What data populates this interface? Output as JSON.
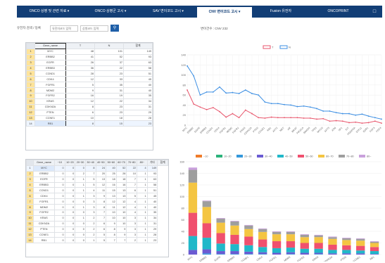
{
  "tabs": [
    {
      "label": "ONCO 상병 및 관련 자료 ▾",
      "active": false
    },
    {
      "label": "ONCO 상병군 고시 ▾",
      "active": false
    },
    {
      "label": "SAV 변이코드 고시 ▾",
      "active": false
    },
    {
      "label": "CNV 변이코드 고시 ▾",
      "active": true
    },
    {
      "label": "Fusion 유전자",
      "active": false
    },
    {
      "label": "ONCOPRINT",
      "active": false
    }
  ],
  "tab_icon": "window-icon",
  "filter": {
    "label": "유전자 검색 / 등록",
    "field1_placeholder": "유전자코드 입력",
    "field2_placeholder": "상병코드 입력",
    "search_icon": "search-icon"
  },
  "status_text": "변이건수 : CNV 232",
  "top_table": {
    "columns": [
      "Gene_name",
      "T",
      "N",
      "합계"
    ],
    "rows": [
      [
        "1",
        "MYC",
        "48",
        "101",
        "149"
      ],
      [
        "2",
        "ERBB2",
        "41",
        "52",
        "93"
      ],
      [
        "3",
        "EGFR",
        "26",
        "37",
        "63"
      ],
      [
        "4",
        "ERBB3",
        "36",
        "22",
        "58"
      ],
      [
        "5",
        "CCND1",
        "28",
        "23",
        "51"
      ],
      [
        "6",
        "CDK4",
        "12",
        "33",
        "45"
      ],
      [
        "7",
        "FGFR1",
        "5",
        "35",
        "40"
      ],
      [
        "8",
        "MDM2",
        "9",
        "31",
        "40"
      ],
      [
        "9",
        "FGFR2",
        "16",
        "19",
        "35"
      ],
      [
        "10",
        "KRAS",
        "12",
        "22",
        "34"
      ],
      [
        "11",
        "CDKN2A",
        "8",
        "23",
        "31"
      ],
      [
        "12",
        "PTEN",
        "6",
        "23",
        "29"
      ],
      [
        "13",
        "CCNE1",
        "10",
        "18",
        "28"
      ],
      [
        "14",
        "RB1",
        "8",
        "15",
        "23"
      ]
    ]
  },
  "bottom_table": {
    "columns": [
      "Gene_name",
      "~10",
      "10~20",
      "20~30",
      "30~40",
      "40~50",
      "50~60",
      "60~70",
      "70~80",
      "80~",
      "기타",
      "합계"
    ],
    "rows": [
      [
        "1",
        "MYC",
        "0",
        "0",
        "0",
        "8",
        "24",
        "40",
        "52",
        "22",
        "4",
        "149"
      ],
      [
        "2",
        "ERBB2",
        "0",
        "0",
        "2",
        "7",
        "20",
        "25",
        "28",
        "10",
        "1",
        "93"
      ],
      [
        "3",
        "EGFR",
        "0",
        "0",
        "1",
        "5",
        "13",
        "18",
        "18",
        "7",
        "1",
        "63"
      ],
      [
        "4",
        "ERBB3",
        "0",
        "0",
        "1",
        "5",
        "12",
        "16",
        "16",
        "7",
        "1",
        "58"
      ],
      [
        "5",
        "CCND1",
        "0",
        "0",
        "1",
        "4",
        "11",
        "15",
        "13",
        "6",
        "1",
        "51"
      ],
      [
        "6",
        "CDK4",
        "0",
        "0",
        "1",
        "3",
        "9",
        "13",
        "13",
        "5",
        "1",
        "45"
      ],
      [
        "7",
        "FGFR1",
        "0",
        "0",
        "0",
        "3",
        "8",
        "12",
        "12",
        "4",
        "1",
        "40"
      ],
      [
        "8",
        "MDM2",
        "0",
        "0",
        "1",
        "3",
        "8",
        "11",
        "12",
        "4",
        "1",
        "40"
      ],
      [
        "9",
        "FGFR2",
        "0",
        "0",
        "0",
        "3",
        "7",
        "10",
        "10",
        "4",
        "1",
        "35"
      ],
      [
        "10",
        "KRAS",
        "0",
        "0",
        "1",
        "2",
        "7",
        "10",
        "10",
        "3",
        "1",
        "34"
      ],
      [
        "11",
        "CDKN2A",
        "0",
        "0",
        "0",
        "2",
        "6",
        "9",
        "10",
        "3",
        "1",
        "31"
      ],
      [
        "12",
        "PTEN",
        "0",
        "0",
        "0",
        "2",
        "6",
        "8",
        "9",
        "3",
        "1",
        "29"
      ],
      [
        "13",
        "CCNE1",
        "0",
        "0",
        "0",
        "2",
        "5",
        "8",
        "9",
        "3",
        "1",
        "28"
      ],
      [
        "14",
        "RB1",
        "0",
        "0",
        "0",
        "1",
        "5",
        "7",
        "7",
        "2",
        "1",
        "23"
      ]
    ]
  },
  "chart_data": [
    {
      "type": "line",
      "categories": [
        "MYC",
        "ERBB2",
        "EGFR",
        "ERBB3",
        "CCND1",
        "CDK4",
        "FGFR1",
        "MDM2",
        "FGFR2",
        "KRAS",
        "CDKN2A",
        "PTEN",
        "CCNE1",
        "RB1",
        "AKT2",
        "MET",
        "AR",
        "BRAF",
        "PIK3CA",
        "SMAD4",
        "TP53",
        "MYCN",
        "AKT3",
        "ATM",
        "NF1",
        "KIT",
        "PDGFRA",
        "STK11",
        "ESR1",
        "FGF3",
        "FGF4"
      ],
      "series": [
        {
          "name": "T",
          "color": "#e8566c",
          "values": [
            70,
            42,
            36,
            31,
            35,
            27,
            16,
            23,
            15,
            30,
            23,
            15,
            14,
            16,
            15,
            15,
            15,
            15,
            14,
            14,
            12,
            13,
            8,
            9,
            8,
            5,
            6,
            4,
            5,
            8,
            4
          ]
        },
        {
          "name": "N",
          "color": "#3d8fe3",
          "values": [
            118,
            98,
            60,
            66,
            66,
            76,
            64,
            65,
            63,
            70,
            63,
            60,
            46,
            43,
            43,
            41,
            40,
            37,
            38,
            36,
            33,
            28,
            28,
            25,
            23,
            23,
            20,
            22,
            18,
            15,
            12
          ]
        }
      ],
      "ylim": [
        0,
        140
      ],
      "yticks": [
        0,
        20,
        40,
        60,
        80,
        100,
        120,
        140
      ],
      "grid": true,
      "legend": "top-center"
    },
    {
      "type": "bar",
      "stacked": true,
      "categories": [
        "MYC",
        "ERBB2",
        "EGFR",
        "ERBB3",
        "CCND1",
        "CDK4",
        "FGFR1",
        "MDM2",
        "FGFR2",
        "KRAS",
        "CDKN2A",
        "PTEN",
        "CCNE1",
        "RB1"
      ],
      "series": [
        {
          "name": "~10",
          "color": "#f07c2a",
          "values": [
            0,
            0,
            0,
            0,
            0,
            0,
            0,
            0,
            0,
            0,
            0,
            0,
            0,
            0
          ]
        },
        {
          "name": "10~20",
          "color": "#2bb37b",
          "values": [
            0,
            0,
            0,
            0,
            0,
            0,
            0,
            0,
            0,
            0,
            0,
            0,
            0,
            0
          ]
        },
        {
          "name": "20~30",
          "color": "#3498db",
          "values": [
            0,
            2,
            1,
            1,
            1,
            1,
            0,
            1,
            0,
            1,
            0,
            0,
            0,
            0
          ]
        },
        {
          "name": "30~40",
          "color": "#6b5bd2",
          "values": [
            8,
            7,
            5,
            5,
            4,
            3,
            3,
            3,
            3,
            2,
            2,
            2,
            2,
            1
          ]
        },
        {
          "name": "40~50",
          "color": "#20b8c9",
          "values": [
            24,
            20,
            13,
            12,
            11,
            9,
            8,
            8,
            7,
            7,
            6,
            6,
            5,
            5
          ]
        },
        {
          "name": "50~60",
          "color": "#f0506e",
          "values": [
            40,
            25,
            18,
            16,
            15,
            13,
            12,
            11,
            10,
            10,
            9,
            8,
            8,
            7
          ]
        },
        {
          "name": "60~70",
          "color": "#f4c542",
          "values": [
            52,
            28,
            18,
            16,
            13,
            13,
            12,
            12,
            10,
            10,
            10,
            9,
            9,
            7
          ]
        },
        {
          "name": "70~80",
          "color": "#9e9e9e",
          "values": [
            22,
            10,
            7,
            7,
            6,
            5,
            4,
            4,
            4,
            3,
            3,
            3,
            3,
            2
          ]
        },
        {
          "name": "80~",
          "color": "#c9a0dc",
          "values": [
            4,
            1,
            1,
            1,
            1,
            1,
            1,
            1,
            1,
            1,
            1,
            1,
            1,
            1
          ]
        }
      ],
      "ylim": [
        0,
        160
      ],
      "yticks": [
        0,
        20,
        40,
        60,
        80,
        100,
        120,
        140,
        160
      ],
      "grid": true,
      "legend": "top"
    }
  ]
}
